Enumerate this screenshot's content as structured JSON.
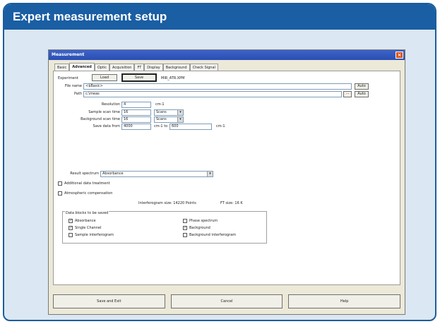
{
  "header": {
    "title": "Expert measurement setup"
  },
  "window": {
    "title": "Measurement",
    "close_glyph": "×"
  },
  "tabs": [
    "Basic",
    "Advanced",
    "Optic",
    "Acquisition",
    "FT",
    "Display",
    "Background",
    "Check Signal"
  ],
  "form": {
    "experiment_label": "Experiment",
    "load_label": "Load",
    "save_label": "Save",
    "experiment_file": "MIR_ATR.XPM",
    "file_name_label": "File name",
    "file_name_value": "<$Basic>",
    "path_label": "Path",
    "path_value": "c:\\meas",
    "auto_label": "Auto",
    "browse_label": "...",
    "resolution_label": "Resolution",
    "resolution_value": "4",
    "resolution_unit": "cm-1",
    "sample_scan_label": "Sample scan time",
    "sample_scan_value": "16",
    "sample_scan_unit": "Scans",
    "background_scan_label": "Background scan time",
    "background_scan_value": "16",
    "background_scan_unit": "Scans",
    "save_from_label": "Save data from",
    "save_from_value": "4000",
    "save_to_label": "cm-1 to",
    "save_to_value": "600",
    "save_to_unit": "cm-1",
    "result_spectrum_label": "Result spectrum",
    "result_spectrum_value": "Absorbance",
    "additional_treatment_label": "Additional data treatment",
    "atmospheric_comp_label": "Atmospheric compensation",
    "interferogram_size_text": "Interferogram size: 14220 Points",
    "ft_size_text": "FT size: 16 K",
    "data_blocks_legend": "Data blocks to be saved",
    "cb_absorbance": "Absorbance",
    "cb_single_channel": "Single Channel",
    "cb_sample_interferogram": "Sample interferogram",
    "cb_phase_spectrum": "Phase spectrum",
    "cb_background": "Background",
    "cb_background_interferogram": "Background interferogram",
    "check_mark": "✓"
  },
  "footer": {
    "save_exit": "Save and Exit",
    "cancel": "Cancel",
    "help": "Help"
  }
}
